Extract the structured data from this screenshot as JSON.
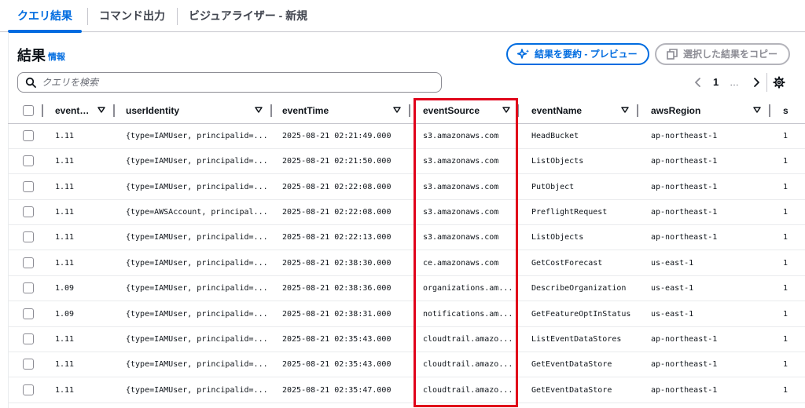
{
  "tabs": [
    {
      "label": "クエリ結果",
      "active": true
    },
    {
      "label": "コマンド出力",
      "active": false
    },
    {
      "label": "ビジュアライザー - 新規",
      "active": false
    }
  ],
  "results": {
    "title": "結果",
    "info_link": "情報",
    "summarize_button": "結果を要約 - プレビュー",
    "copy_button": "選択した結果をコピー",
    "search_placeholder": "クエリを検索"
  },
  "pagination": {
    "current_page": "1",
    "ellipsis": "…"
  },
  "table": {
    "columns": [
      "event…",
      "userIdentity",
      "eventTime",
      "eventSource",
      "eventName",
      "awsRegion",
      "s"
    ],
    "rows": [
      [
        "1.11",
        "{type=IAMUser, principalid=...",
        "2025-08-21 02:21:49.000",
        "s3.amazonaws.com",
        "HeadBucket",
        "ap-northeast-1",
        "1"
      ],
      [
        "1.11",
        "{type=IAMUser, principalid=...",
        "2025-08-21 02:21:50.000",
        "s3.amazonaws.com",
        "ListObjects",
        "ap-northeast-1",
        "1"
      ],
      [
        "1.11",
        "{type=IAMUser, principalid=...",
        "2025-08-21 02:22:08.000",
        "s3.amazonaws.com",
        "PutObject",
        "ap-northeast-1",
        "1"
      ],
      [
        "1.11",
        "{type=AWSAccount, principal...",
        "2025-08-21 02:22:08.000",
        "s3.amazonaws.com",
        "PreflightRequest",
        "ap-northeast-1",
        "1"
      ],
      [
        "1.11",
        "{type=IAMUser, principalid=...",
        "2025-08-21 02:22:13.000",
        "s3.amazonaws.com",
        "ListObjects",
        "ap-northeast-1",
        "1"
      ],
      [
        "1.11",
        "{type=IAMUser, principalid=...",
        "2025-08-21 02:38:30.000",
        "ce.amazonaws.com",
        "GetCostForecast",
        "us-east-1",
        "1"
      ],
      [
        "1.09",
        "{type=IAMUser, principalid=...",
        "2025-08-21 02:38:36.000",
        "organizations.am...",
        "DescribeOrganization",
        "us-east-1",
        "1"
      ],
      [
        "1.09",
        "{type=IAMUser, principalid=...",
        "2025-08-21 02:38:31.000",
        "notifications.am...",
        "GetFeatureOptInStatus",
        "us-east-1",
        "1"
      ],
      [
        "1.11",
        "{type=IAMUser, principalid=...",
        "2025-08-21 02:35:43.000",
        "cloudtrail.amazo...",
        "ListEventDataStores",
        "ap-northeast-1",
        "1"
      ],
      [
        "1.11",
        "{type=IAMUser, principalid=...",
        "2025-08-21 02:35:43.000",
        "cloudtrail.amazo...",
        "GetEventDataStore",
        "ap-northeast-1",
        "1"
      ],
      [
        "1.11",
        "{type=IAMUser, principalid=...",
        "2025-08-21 02:35:47.000",
        "cloudtrail.amazo...",
        "GetEventDataStore",
        "ap-northeast-1",
        "1"
      ]
    ]
  },
  "icons": {
    "summarize": "sparkle-icon",
    "copy": "copy-icon",
    "search": "search-icon",
    "prev": "chevron-left-icon",
    "next": "chevron-right-icon",
    "settings": "gear-icon",
    "sort": "caret-down-icon"
  },
  "colors": {
    "accent": "#006ce0",
    "highlight": "#e0001a",
    "text": "#0f141a",
    "muted": "#8c8c94"
  }
}
